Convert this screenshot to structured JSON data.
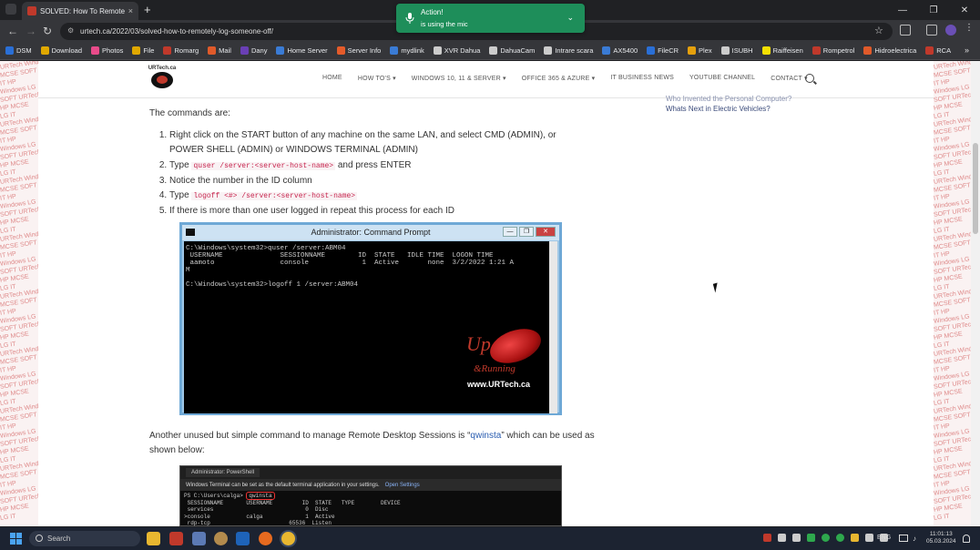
{
  "browser": {
    "tab_title": "SOLVED: How To Remotely Lo...",
    "tab_close": "×",
    "new_tab": "+",
    "url": "urtech.ca/2022/03/solved-how-to-remotely-log-someone-off/",
    "window_controls": [
      "—",
      "❐",
      "✕"
    ],
    "nav": {
      "back": "←",
      "forward": "→",
      "reload": "↻"
    },
    "star": "☆"
  },
  "bookmarks": [
    {
      "label": "DSM",
      "color": "#2a6fd6"
    },
    {
      "label": "Download",
      "color": "#e0a800"
    },
    {
      "label": "Photos",
      "color": "#e94b8a"
    },
    {
      "label": "File",
      "color": "#e0a800"
    },
    {
      "label": "Romarg",
      "color": "#c0392b"
    },
    {
      "label": "Mail",
      "color": "#e05a2a"
    },
    {
      "label": "Dany",
      "color": "#6a3fb5"
    },
    {
      "label": "Home Server",
      "color": "#3a7bd5"
    },
    {
      "label": "Server Info",
      "color": "#e55b2a"
    },
    {
      "label": "mydlink",
      "color": "#3a7bd5"
    },
    {
      "label": "XVR Dahua",
      "color": "#cccccc"
    },
    {
      "label": "DahuaCam",
      "color": "#cccccc"
    },
    {
      "label": "Intrare scara",
      "color": "#cccccc"
    },
    {
      "label": "AX5400",
      "color": "#3a7bd5"
    },
    {
      "label": "FileCR",
      "color": "#2a6fd6"
    },
    {
      "label": "Plex",
      "color": "#e5a00d"
    },
    {
      "label": "ISUBH",
      "color": "#cccccc"
    },
    {
      "label": "Raiffeisen",
      "color": "#f5e000"
    },
    {
      "label": "Rompetrol",
      "color": "#c0392b"
    },
    {
      "label": "Hidroelectrica",
      "color": "#e05a2a"
    },
    {
      "label": "RCA",
      "color": "#c0392b"
    }
  ],
  "bookmarks_more": "»",
  "notification": {
    "title": "Action!",
    "body": "is using the mic",
    "chevron": "⌄"
  },
  "site": {
    "logo_text": "URTech.ca",
    "nav": [
      "HOME",
      "HOW TO'S ▾",
      "WINDOWS 10, 11 & SERVER ▾",
      "OFFICE 365 & AZURE ▾",
      "IT BUSINESS NEWS",
      "YOUTUBE CHANNEL",
      "CONTACT ▾"
    ],
    "sidebar_links": [
      "Who Invented the Personal Computer?",
      "Whats Next in Electric Vehicles?"
    ]
  },
  "article": {
    "intro": "The commands are:",
    "steps": [
      {
        "pre": "Right click on the START button of any machine on the same LAN, and select CMD (ADMIN), or POWER SHELL (ADMIN) or WINDOWS TERMINAL (ADMIN)",
        "code": "",
        "post": ""
      },
      {
        "pre": "Type ",
        "code": "quser /server:<server-host-name>",
        "post": " and press ENTER"
      },
      {
        "pre": "Notice the number in the ID column",
        "code": "",
        "post": ""
      },
      {
        "pre": "Type ",
        "code": "logoff <#> /server:<server-host-name>",
        "post": ""
      },
      {
        "pre": "If there is more than one user logged in repeat this process for each ID",
        "code": "",
        "post": ""
      }
    ],
    "cmd_window": {
      "title": "Administrator: Command Prompt",
      "buttons": [
        "—",
        "❐",
        "✕"
      ],
      "lines": [
        "C:\\Windows\\system32>quser /server:ABM04",
        " USERNAME              SESSIONNAME        ID  STATE   IDLE TIME  LOGON TIME",
        " aamoto                console             1  Active       none  3/2/2022 1:21 A",
        "M",
        "",
        "C:\\Windows\\system32>logoff 1 /server:ABM04"
      ],
      "brand_up": "Up",
      "brand_running": "&Running",
      "brand_url": "www.URTech.ca"
    },
    "para2_pre": "Another unused but simple command to manage Remote Desktop Sessions is “",
    "para2_link": "qwinsta",
    "para2_post": "” which can be used as shown below:",
    "ps_window": {
      "tab": "Administrator: PowerShell",
      "info": "Windows Terminal can be set as the default terminal application in your settings.",
      "info_link": "Open Settings",
      "prompt": "PS C:\\Users\\calga> ",
      "command": "qwinsta",
      "lines": [
        " SESSIONNAME       USERNAME         ID  STATE   TYPE        DEVICE",
        " services                            0  Disc",
        ">console           calga             1  Active",
        " rdp-tcp                        65536  Listen"
      ]
    }
  },
  "taskbar": {
    "search_placeholder": "Search",
    "language": "ENG",
    "time": "11:01:13",
    "date": "05.03.2024"
  }
}
